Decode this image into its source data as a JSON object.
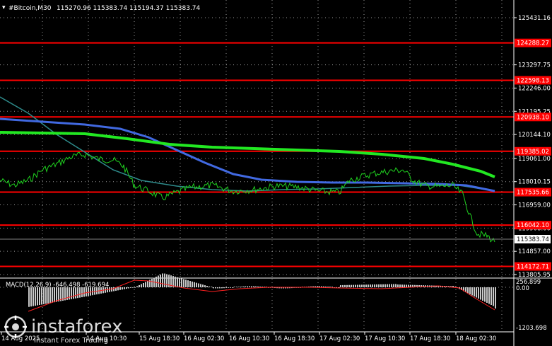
{
  "header": {
    "symbol": "#Bitcoin,M30",
    "ohlc": "115270.96 115383.74 115194.37 115383.74"
  },
  "price_axis": {
    "ticks": [
      "125431.16",
      "123297.75",
      "122246.00",
      "121195.25",
      "120144.10",
      "119061.00",
      "118010.15",
      "116959.00",
      "115908.00",
      "114857.00",
      "113805.95"
    ],
    "current_price": "115383.74"
  },
  "levels": [
    {
      "label": "124288.27",
      "value": 124288.27
    },
    {
      "label": "122598.13",
      "value": 122598.13
    },
    {
      "label": "120938.10",
      "value": 120938.1
    },
    {
      "label": "119385.02",
      "value": 119385.02
    },
    {
      "label": "117535.66",
      "value": 117535.66
    },
    {
      "label": "116042.10",
      "value": 116042.1
    },
    {
      "label": "114172.71",
      "value": 114172.71
    }
  ],
  "macd": {
    "label": "MACD(12,26,9) -646.498 -619.694",
    "ticks": [
      "256.899",
      "0.00",
      "-1203.698"
    ]
  },
  "time_axis": {
    "labels": [
      "14 Aug 2025",
      "14 Aug 10:30",
      "15 Aug 18:30",
      "16 Aug 02:30",
      "16 Aug 10:30",
      "16 Aug 18:30",
      "17 Aug 02:30",
      "17 Aug 10:30",
      "17 Aug 18:30",
      "18 Aug 02:30"
    ]
  },
  "watermark": {
    "brand": "instaforex",
    "tagline": "Instant Forex Trading"
  },
  "colors": {
    "grid": "#ffffff",
    "level_line": "#ff0000",
    "price_line": "#1fd11f",
    "ma_fast": "#2e8b8b",
    "ma_mid": "#4169e1",
    "ma_slow": "#22e822",
    "macd_hist": "#c8c8c8",
    "macd_signal": "#ff2020"
  }
}
